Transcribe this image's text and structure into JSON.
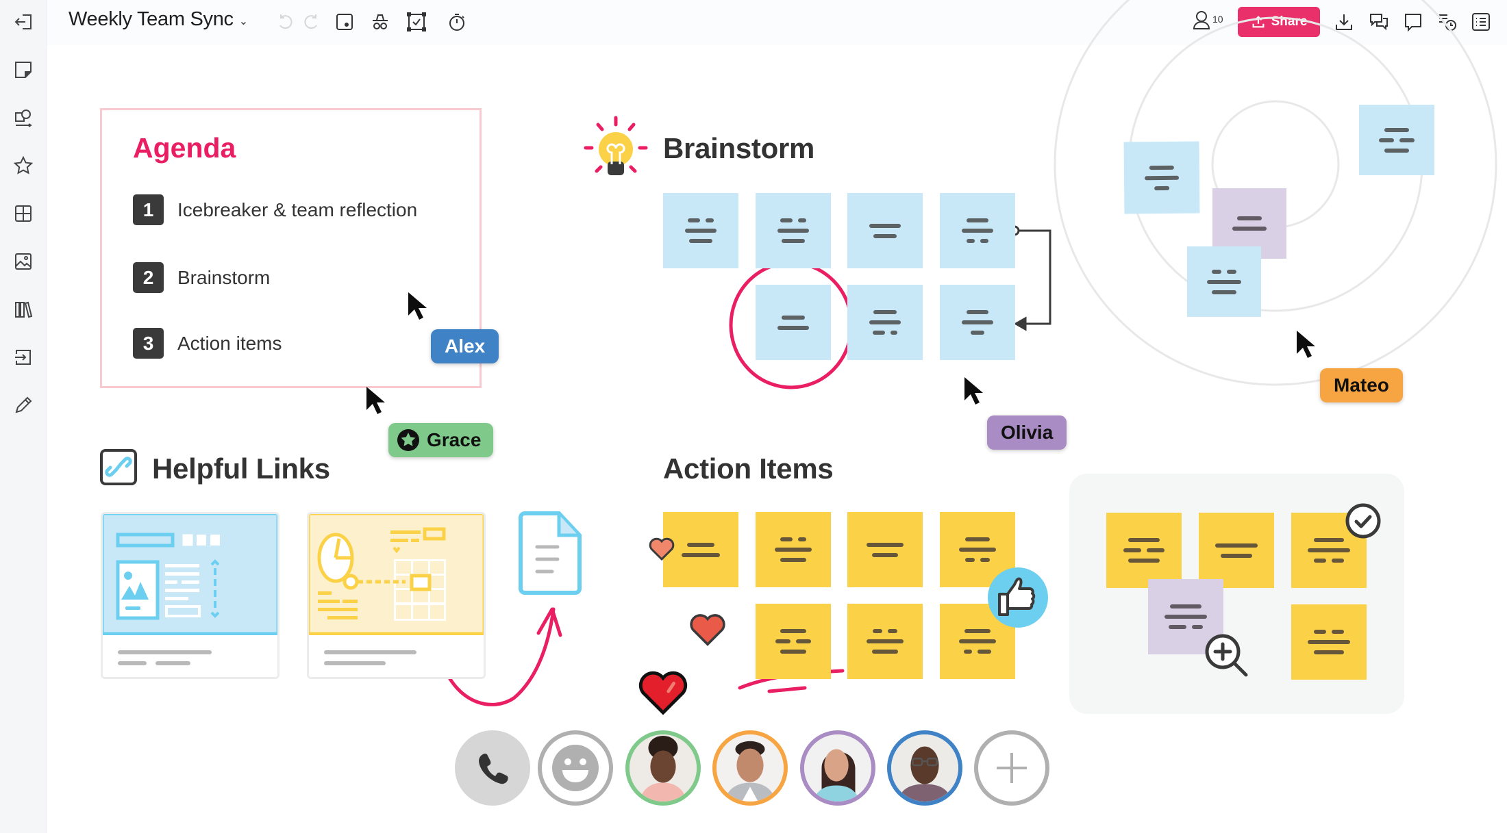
{
  "app": {
    "board_title": "Weekly Team Sync",
    "board_title_menu_icon": "chevron-down-icon"
  },
  "sidebar": {
    "items": [
      {
        "name": "exit-board",
        "icon": "exit-icon"
      },
      {
        "name": "sticky-notes",
        "icon": "sticky-note-icon"
      },
      {
        "name": "shapes-lines",
        "icon": "shapes-icon"
      },
      {
        "name": "stickers",
        "icon": "star-icon"
      },
      {
        "name": "templates",
        "icon": "grid-icon"
      },
      {
        "name": "images",
        "icon": "image-icon"
      },
      {
        "name": "library",
        "icon": "library-icon"
      },
      {
        "name": "import",
        "icon": "import-icon"
      },
      {
        "name": "draw",
        "icon": "pencil-icon"
      }
    ]
  },
  "toolbar": {
    "left_tools": [
      {
        "name": "undo",
        "icon": "undo-icon",
        "enabled": false
      },
      {
        "name": "redo",
        "icon": "redo-icon",
        "enabled": false
      },
      {
        "name": "laser-pointer",
        "icon": "laser-pointer-icon"
      },
      {
        "name": "private-mode",
        "icon": "incognito-icon"
      },
      {
        "name": "voting",
        "icon": "vote-check-icon"
      },
      {
        "name": "timer",
        "icon": "stopwatch-icon"
      }
    ],
    "users_online": "10",
    "share_label": "Share",
    "right_tools": [
      {
        "name": "export",
        "icon": "download-icon"
      },
      {
        "name": "chat",
        "icon": "chat-bubbles-icon"
      },
      {
        "name": "comments",
        "icon": "comment-icon"
      },
      {
        "name": "activity",
        "icon": "activity-history-icon"
      },
      {
        "name": "board-outline",
        "icon": "list-icon"
      }
    ]
  },
  "agenda": {
    "title": "Agenda",
    "items": [
      {
        "number": "1",
        "label": "Icebreaker & team reflection"
      },
      {
        "number": "2",
        "label": "Brainstorm"
      },
      {
        "number": "3",
        "label": "Action items"
      }
    ]
  },
  "sections": {
    "brainstorm_title": "Brainstorm",
    "helpful_links_title": "Helpful Links",
    "action_items_title": "Action Items"
  },
  "collaborators": [
    {
      "name": "Alex",
      "color": "#3f83c6",
      "text_color": "#ffffff"
    },
    {
      "name": "Grace",
      "color": "#7fca8b",
      "text_color": "#111111",
      "badge": "star-icon"
    },
    {
      "name": "Olivia",
      "color": "#a98cc3",
      "text_color": "#111111"
    },
    {
      "name": "Mateo",
      "color": "#f7a543",
      "text_color": "#111111"
    }
  ],
  "colors": {
    "accent": "#e9306a",
    "sticky_blue": "#c8e8f7",
    "sticky_yellow": "#fbd247",
    "sticky_purple": "#d9d0e6",
    "agenda_border": "#f8c9cf"
  },
  "call_bar": {
    "buttons": [
      {
        "name": "call",
        "icon": "phone-icon"
      },
      {
        "name": "reactions",
        "icon": "smiley-icon"
      },
      {
        "name": "participant-1",
        "ring_color": "#7fca8b"
      },
      {
        "name": "participant-2",
        "ring_color": "#f7a543"
      },
      {
        "name": "participant-3",
        "ring_color": "#a98cc3"
      },
      {
        "name": "participant-4",
        "ring_color": "#3f83c6"
      },
      {
        "name": "invite",
        "icon": "plus-icon"
      }
    ]
  }
}
